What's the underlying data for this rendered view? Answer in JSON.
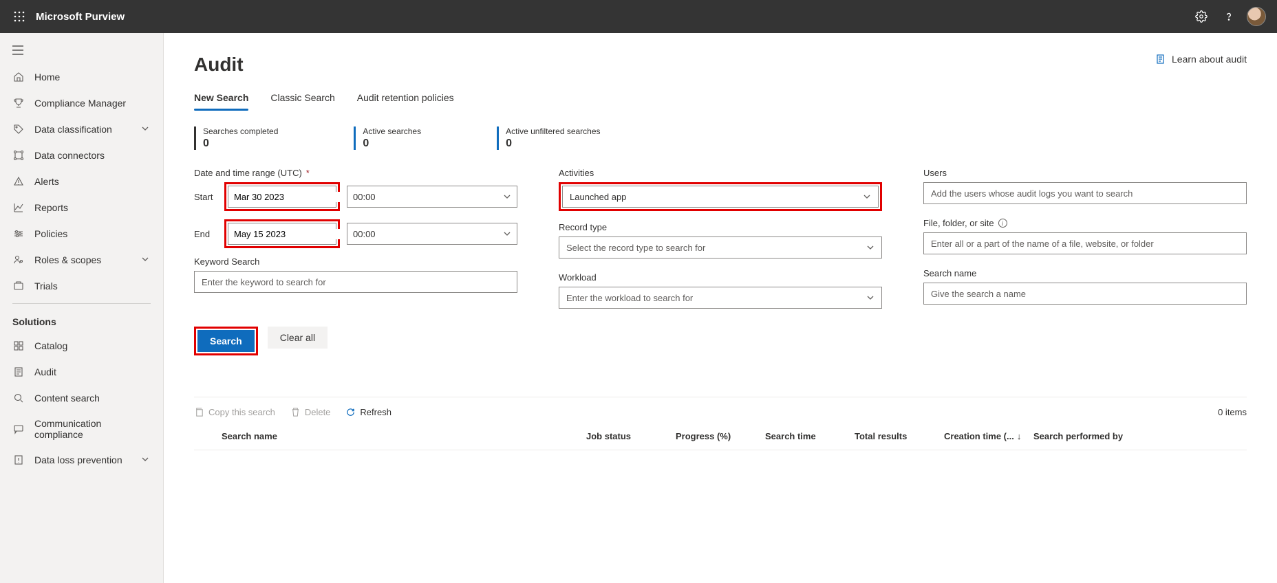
{
  "header": {
    "app": "Microsoft Purview"
  },
  "sidebar": {
    "items": [
      {
        "label": "Home"
      },
      {
        "label": "Compliance Manager"
      },
      {
        "label": "Data classification"
      },
      {
        "label": "Data connectors"
      },
      {
        "label": "Alerts"
      },
      {
        "label": "Reports"
      },
      {
        "label": "Policies"
      },
      {
        "label": "Roles & scopes"
      },
      {
        "label": "Trials"
      }
    ],
    "section": "Solutions",
    "solutions": [
      {
        "label": "Catalog"
      },
      {
        "label": "Audit"
      },
      {
        "label": "Content search"
      },
      {
        "label": "Communication compliance"
      },
      {
        "label": "Data loss prevention"
      }
    ]
  },
  "page": {
    "title": "Audit",
    "learn": "Learn about audit",
    "tabs": [
      "New Search",
      "Classic Search",
      "Audit retention policies"
    ],
    "stats": [
      {
        "label": "Searches completed",
        "value": "0"
      },
      {
        "label": "Active searches",
        "value": "0"
      },
      {
        "label": "Active unfiltered searches",
        "value": "0"
      }
    ]
  },
  "form": {
    "dateRangeLabel": "Date and time range (UTC)",
    "startLbl": "Start",
    "endLbl": "End",
    "startDate": "Mar 30 2023",
    "startTime": "00:00",
    "endDate": "May 15 2023",
    "endTime": "00:00",
    "keywordLabel": "Keyword Search",
    "keywordPlaceholder": "Enter the keyword to search for",
    "activitiesLabel": "Activities",
    "activitiesValue": "Launched app",
    "recordTypeLabel": "Record type",
    "recordTypePlaceholder": "Select the record type to search for",
    "workloadLabel": "Workload",
    "workloadPlaceholder": "Enter the workload to search for",
    "usersLabel": "Users",
    "usersPlaceholder": "Add the users whose audit logs you want to search",
    "fileLabel": "File, folder, or site",
    "filePlaceholder": "Enter all or a part of the name of a file, website, or folder",
    "searchNameLabel": "Search name",
    "searchNamePlaceholder": "Give the search a name",
    "searchBtn": "Search",
    "clearBtn": "Clear all"
  },
  "results": {
    "copy": "Copy this search",
    "delete": "Delete",
    "refresh": "Refresh",
    "items": "0 items",
    "cols": {
      "search": "Search name",
      "job": "Job status",
      "progress": "Progress (%)",
      "time": "Search time",
      "total": "Total results",
      "ctime": "Creation time (...",
      "perf": "Search performed by"
    }
  }
}
